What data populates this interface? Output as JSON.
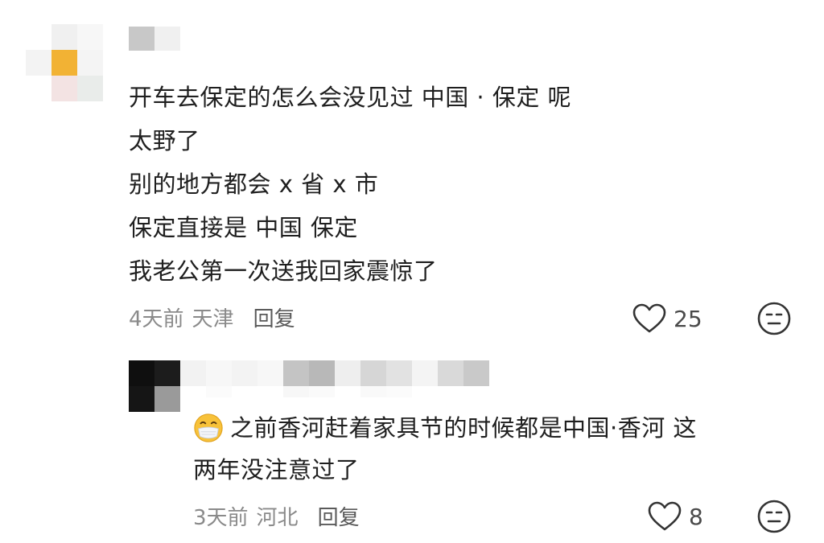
{
  "comment": {
    "lines": [
      "开车去保定的怎么会没见过  中国 · 保定 呢",
      "太野了",
      "别的地方都会 x 省 x 市",
      "保定直接是 中国  保定",
      "我老公第一次送我回家震惊了"
    ],
    "time": "4天前",
    "location": "天津",
    "reply_label": "回复",
    "like_icon": "heart-outline-icon",
    "like_count": "25",
    "dislike_icon": "neutral-face-icon"
  },
  "reply": {
    "emoji": "face-with-medical-mask-emoji",
    "lines": [
      "之前香河赶着家具节的时候都是中国·香河 这",
      "两年没注意过了"
    ],
    "time": "3天前",
    "location": "河北",
    "reply_label": "回复",
    "like_icon": "heart-outline-icon",
    "like_count": "8",
    "dislike_icon": "neutral-face-icon"
  },
  "colors": {
    "text": "#1f1f1f",
    "meta": "#8a8a8a",
    "icon": "#333333",
    "avatar_accent": "#f2b234"
  }
}
